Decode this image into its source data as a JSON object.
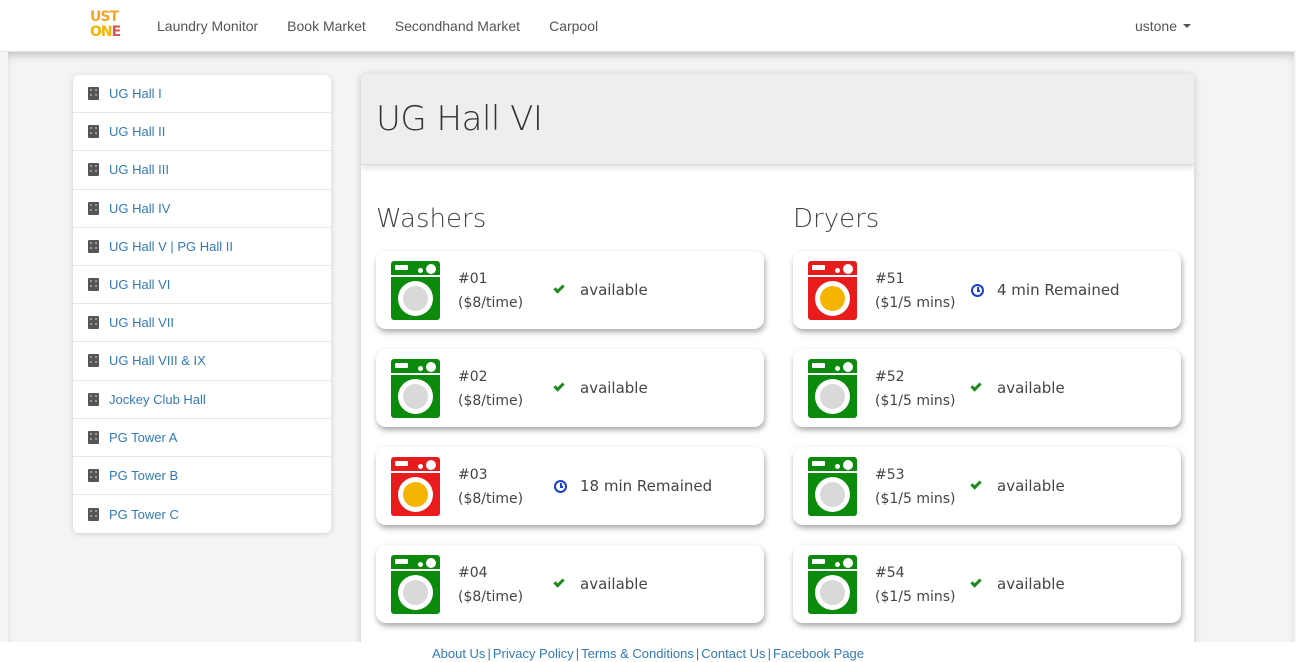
{
  "brand": {
    "line1": "UST",
    "line2a": "ON",
    "line2b": "E"
  },
  "nav": {
    "links": [
      "Laundry Monitor",
      "Book Market",
      "Secondhand Market",
      "Carpool"
    ],
    "user": "ustone"
  },
  "sidebar": {
    "items": [
      "UG Hall I",
      "UG Hall II",
      "UG Hall III",
      "UG Hall IV",
      "UG Hall V | PG Hall II",
      "UG Hall VI",
      "UG Hall VII",
      "UG Hall VIII & IX",
      "Jockey Club Hall",
      "PG Tower A",
      "PG Tower B",
      "PG Tower C"
    ]
  },
  "panel": {
    "title": "UG Hall VI",
    "washers_title": "Washers",
    "dryers_title": "Dryers"
  },
  "washers": [
    {
      "num": "#01",
      "price": "($8/time)",
      "status": "available",
      "busy": false
    },
    {
      "num": "#02",
      "price": "($8/time)",
      "status": "available",
      "busy": false
    },
    {
      "num": "#03",
      "price": "($8/time)",
      "status": "18 min Remained",
      "busy": true
    },
    {
      "num": "#04",
      "price": "($8/time)",
      "status": "available",
      "busy": false
    }
  ],
  "dryers": [
    {
      "num": "#51",
      "price": "($1/5 mins)",
      "status": "4 min Remained",
      "busy": true
    },
    {
      "num": "#52",
      "price": "($1/5 mins)",
      "status": "available",
      "busy": false
    },
    {
      "num": "#53",
      "price": "($1/5 mins)",
      "status": "available",
      "busy": false
    },
    {
      "num": "#54",
      "price": "($1/5 mins)",
      "status": "available",
      "busy": false
    }
  ],
  "colors": {
    "free": "#0b8a0b",
    "busy": "#e81c1c",
    "link": "#337ab7"
  },
  "icons": {
    "available": "check-icon",
    "busy": "clock-icon",
    "sidebar": "building-icon"
  },
  "footer": {
    "links": [
      "About Us",
      "Privacy Policy",
      "Terms & Conditions",
      "Contact Us",
      "Facebook Page"
    ],
    "separator": "|"
  }
}
